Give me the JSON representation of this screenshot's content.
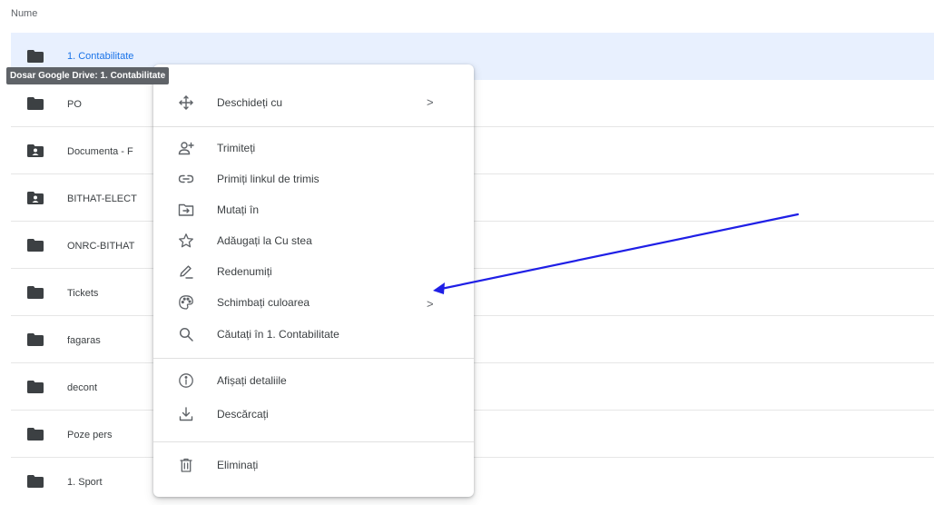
{
  "column_header": "Nume",
  "files": [
    {
      "name": "1. Contabilitate",
      "icon": "folder-icon",
      "selected": true
    },
    {
      "name": "PO",
      "icon": "folder-icon"
    },
    {
      "name": "Documenta - F",
      "icon": "shared-folder-icon"
    },
    {
      "name": "BITHAT-ELECT",
      "icon": "shared-folder-icon"
    },
    {
      "name": "ONRC-BITHAT",
      "icon": "folder-icon"
    },
    {
      "name": "Tickets",
      "icon": "folder-icon"
    },
    {
      "name": "fagaras",
      "icon": "folder-icon"
    },
    {
      "name": "decont",
      "icon": "folder-icon"
    },
    {
      "name": "Poze pers",
      "icon": "folder-icon"
    },
    {
      "name": "1. Sport",
      "icon": "folder-icon"
    }
  ],
  "tooltip": "Dosar Google Drive: 1. Contabilitate",
  "context_menu": {
    "open_with": "Deschideți cu",
    "share": "Trimiteți",
    "get_link": "Primiți linkul de trimis",
    "move_to": "Mutați în",
    "add_star": "Adăugați la Cu stea",
    "rename": "Redenumiți",
    "change_color": "Schimbați culoarea",
    "search_in": "Căutați în 1. Contabilitate",
    "view_details": "Afișați detaliile",
    "download": "Descărcați",
    "remove": "Eliminați",
    "submenu_chevron": ">"
  },
  "colors": {
    "selected_row_bg": "#e8f0fe",
    "selected_text": "#1a73e8",
    "folder_icon": "#3c4043",
    "annotation_arrow": "#1f1fe6"
  }
}
